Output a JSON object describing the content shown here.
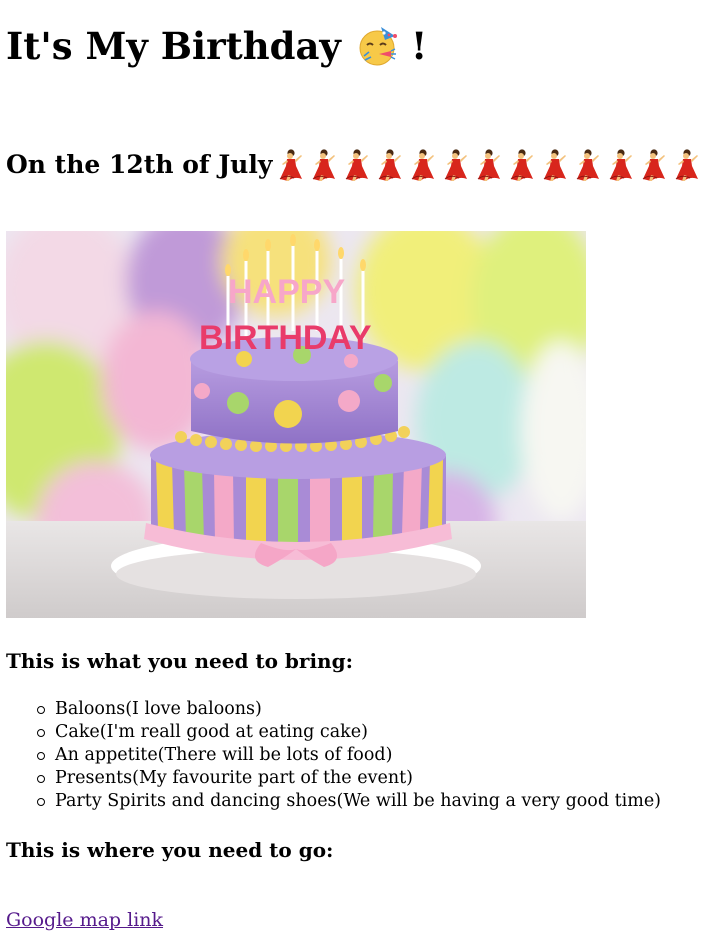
{
  "page": {
    "title_text": "It's My Birthday",
    "title_emoji": "partying-face-icon",
    "title_suffix": "!",
    "date_heading": "On the 12th of July",
    "dancer_icon": "woman-dancing-icon",
    "dancer_count": 13,
    "image": {
      "subject": "birthday-cake-photo",
      "cake_topper_line1": "HAPPY",
      "cake_topper_line2": "BIRTHDAY"
    },
    "bring_heading": "This is what you need to bring:",
    "bring_items": [
      "Baloons(I love baloons)",
      "Cake(I'm reall good at eating cake)",
      "An appetite(There will be lots of food)",
      "Presents(My favourite part of the event)",
      "Party Spirits and dancing shoes(We will be having a very good time)"
    ],
    "go_heading": "This is where you need to go:",
    "map_link_text": "Google map link"
  },
  "colors": {
    "link_visited": "#551a8b",
    "cake_purple": "#a98bd6",
    "cake_pink": "#f4a9c8",
    "cake_yellow": "#f2d44f",
    "cake_green": "#a8d66b",
    "dancer_red": "#d8261c"
  }
}
